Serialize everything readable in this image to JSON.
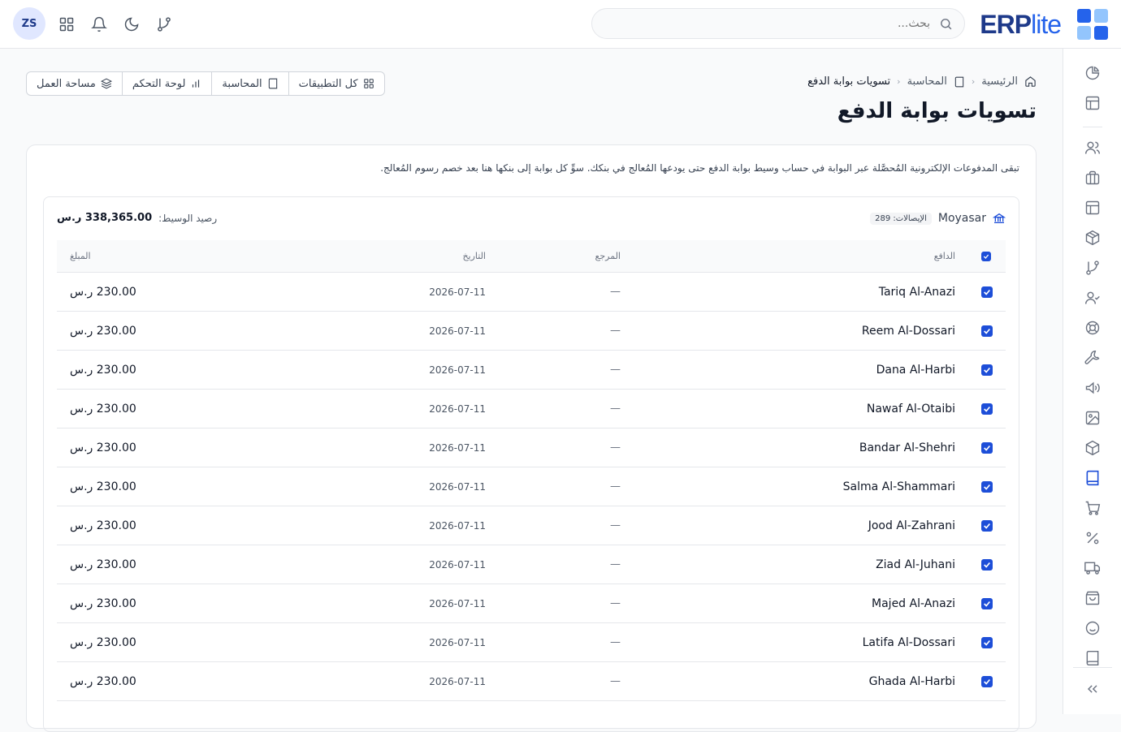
{
  "app": {
    "logo_main": "ERP",
    "logo_sub": "lite",
    "user_initials": "ZS"
  },
  "search": {
    "placeholder": "بحث..."
  },
  "colors": {
    "brand_dark": "#1e3a8a",
    "brand": "#2563eb",
    "accent_check": "#1d4ed8"
  },
  "breadcrumb": {
    "home": "الرئيسية",
    "section": "المحاسبة",
    "current": "تسويات بوابة الدفع"
  },
  "page": {
    "title": "تسويات بوابة الدفع",
    "description": "تبقى المدفوعات الإلكترونية المُحصَّلة عبر البوابة في حساب وسيط بوابة الدفع حتى يودعها المُعالج في بنكك. سوِّ كل بوابة إلى بنكها هنا بعد خصم رسوم المُعالج."
  },
  "quick_links": {
    "all_apps": "كل التطبيقات",
    "accounting": "المحاسبة",
    "dashboard": "لوحة التحكم",
    "workspace": "مساحة العمل"
  },
  "gateway": {
    "name": "Moyasar",
    "receipts_badge": "الإيصالات: 289",
    "balance_label": "رصيد الوسيط:",
    "balance_value": "338,365.00 ر.س"
  },
  "table": {
    "headers": {
      "payer": "الدافع",
      "reference": "المرجع",
      "date": "التاريخ",
      "amount": "المبلغ"
    },
    "rows": [
      {
        "payer": "Tariq Al-Anazi",
        "reference": "—",
        "date": "2026-07-11",
        "amount": "230.00 ر.س",
        "checked": true
      },
      {
        "payer": "Reem Al-Dossari",
        "reference": "—",
        "date": "2026-07-11",
        "amount": "230.00 ر.س",
        "checked": true
      },
      {
        "payer": "Dana Al-Harbi",
        "reference": "—",
        "date": "2026-07-11",
        "amount": "230.00 ر.س",
        "checked": true
      },
      {
        "payer": "Nawaf Al-Otaibi",
        "reference": "—",
        "date": "2026-07-11",
        "amount": "230.00 ر.س",
        "checked": true
      },
      {
        "payer": "Bandar Al-Shehri",
        "reference": "—",
        "date": "2026-07-11",
        "amount": "230.00 ر.س",
        "checked": true
      },
      {
        "payer": "Salma Al-Shammari",
        "reference": "—",
        "date": "2026-07-11",
        "amount": "230.00 ر.س",
        "checked": true
      },
      {
        "payer": "Jood Al-Zahrani",
        "reference": "—",
        "date": "2026-07-11",
        "amount": "230.00 ر.س",
        "checked": true
      },
      {
        "payer": "Ziad Al-Juhani",
        "reference": "—",
        "date": "2026-07-11",
        "amount": "230.00 ر.س",
        "checked": true
      },
      {
        "payer": "Majed Al-Anazi",
        "reference": "—",
        "date": "2026-07-11",
        "amount": "230.00 ر.س",
        "checked": true
      },
      {
        "payer": "Latifa Al-Dossari",
        "reference": "—",
        "date": "2026-07-11",
        "amount": "230.00 ر.س",
        "checked": true
      },
      {
        "payer": "Ghada Al-Harbi",
        "reference": "—",
        "date": "2026-07-11",
        "amount": "230.00 ر.س",
        "checked": true
      }
    ]
  },
  "sidebar_icons": [
    "pie-chart-icon",
    "layout-icon",
    "users-icon",
    "briefcase-icon",
    "table-icon",
    "package-icon",
    "git-branch-icon",
    "user-check-icon",
    "lifebuoy-icon",
    "wrench-icon",
    "megaphone-icon",
    "image-icon",
    "box-icon",
    "book-icon",
    "cart-icon",
    "percent-icon",
    "truck-icon",
    "shopping-bag-icon",
    "smile-icon",
    "notebook-icon",
    "collapse-icon"
  ]
}
